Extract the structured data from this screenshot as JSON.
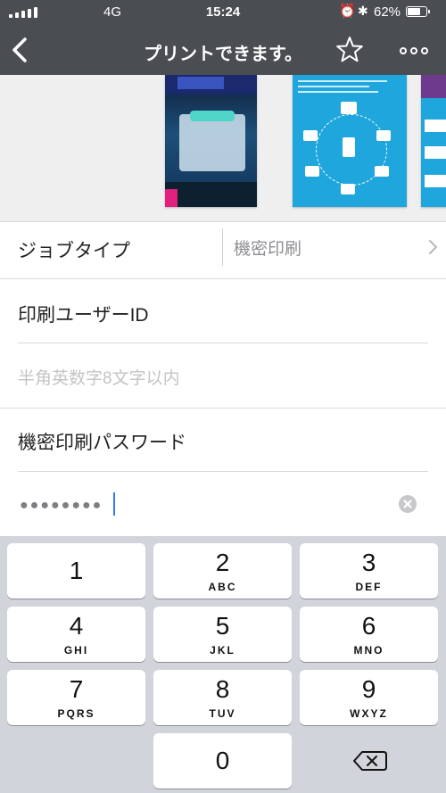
{
  "status_bar": {
    "network": "4G",
    "time": "15:24",
    "battery": "62%",
    "battery_level": 0.62
  },
  "nav": {
    "title": "プリントできます。",
    "back_icon": "chevron-left-icon",
    "favorite_icon": "star-outline-icon",
    "more_icon": "more-horizontal-icon"
  },
  "form": {
    "job_type": {
      "label": "ジョブタイプ",
      "value": "機密印刷"
    },
    "user_id": {
      "label": "印刷ユーザーID",
      "placeholder": "半角英数字8文字以内"
    },
    "password": {
      "label": "機密印刷パスワード",
      "value": "●●●●●●●●"
    }
  },
  "keypad": {
    "keys": [
      {
        "num": "1",
        "letters": ""
      },
      {
        "num": "2",
        "letters": "ABC"
      },
      {
        "num": "3",
        "letters": "DEF"
      },
      {
        "num": "4",
        "letters": "GHI"
      },
      {
        "num": "5",
        "letters": "JKL"
      },
      {
        "num": "6",
        "letters": "MNO"
      },
      {
        "num": "7",
        "letters": "PQRS"
      },
      {
        "num": "8",
        "letters": "TUV"
      },
      {
        "num": "9",
        "letters": "WXYZ"
      },
      {
        "num": "0",
        "letters": ""
      }
    ]
  },
  "colors": {
    "nav_bg": "#4a4d52",
    "keyboard_bg": "#d1d4da",
    "caret": "#3478f6"
  }
}
